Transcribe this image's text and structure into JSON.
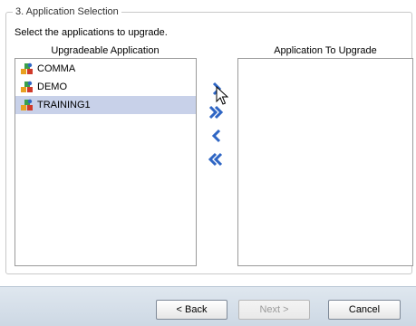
{
  "section": {
    "legend": "3. Application Selection",
    "instructions": "Select the applications to upgrade."
  },
  "source_list": {
    "title": "Upgradeable Application",
    "items": [
      {
        "label": "COMMA",
        "selected": false
      },
      {
        "label": "DEMO",
        "selected": false
      },
      {
        "label": "TRAINING1",
        "selected": true
      }
    ]
  },
  "target_list": {
    "title": "Application To Upgrade",
    "items": []
  },
  "move_buttons": {
    "add": "add-selected-icon",
    "add_all": "add-all-icon",
    "remove": "remove-selected-icon",
    "remove_all": "remove-all-icon"
  },
  "footer": {
    "back_label": "< Back",
    "next_label": "Next >",
    "cancel_label": "Cancel",
    "next_enabled": false
  },
  "colors": {
    "accent_blue": "#2f66c4",
    "selection": "#c8d1e9"
  }
}
